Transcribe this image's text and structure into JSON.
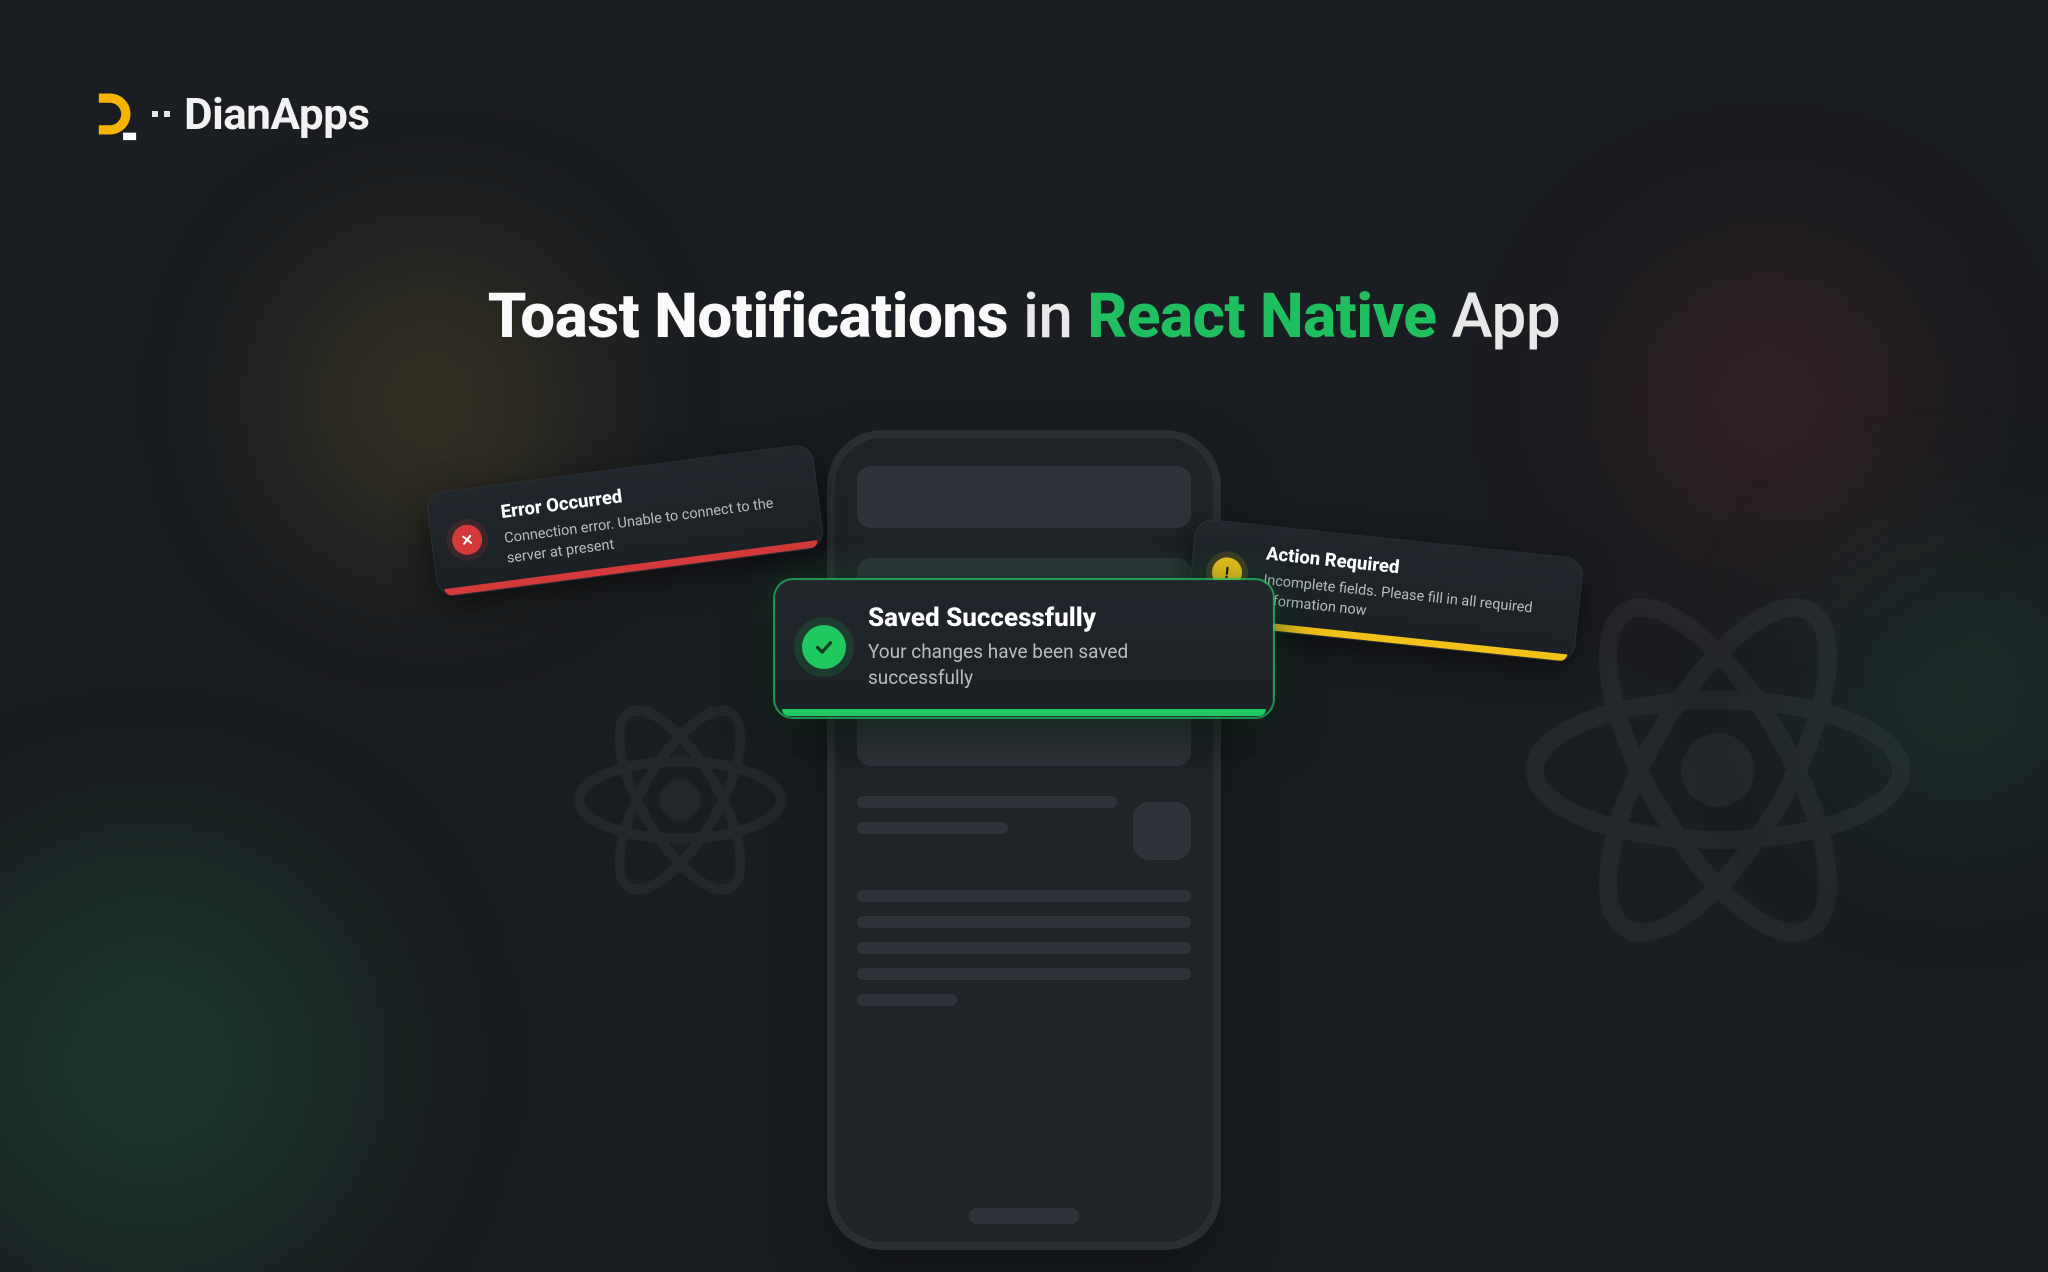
{
  "brand": {
    "name": "DianApps"
  },
  "heading": {
    "part1": "Toast Notifications",
    "part2": "in",
    "part3": "React Native",
    "part4": "App"
  },
  "toasts": {
    "success": {
      "title": "Saved Successfully",
      "description": "Your changes have been saved successfully"
    },
    "error": {
      "title": "Error Occurred",
      "description": "Connection error. Unable to connect to the server at present"
    },
    "warning": {
      "title": "Action Required",
      "description": "Incomplete fields. Please fill in all required information now"
    }
  },
  "colors": {
    "accent_green": "#1fbf5f",
    "accent_red": "#d43a3a",
    "accent_yellow": "#f2c21a",
    "bg": "#1a1d21"
  }
}
